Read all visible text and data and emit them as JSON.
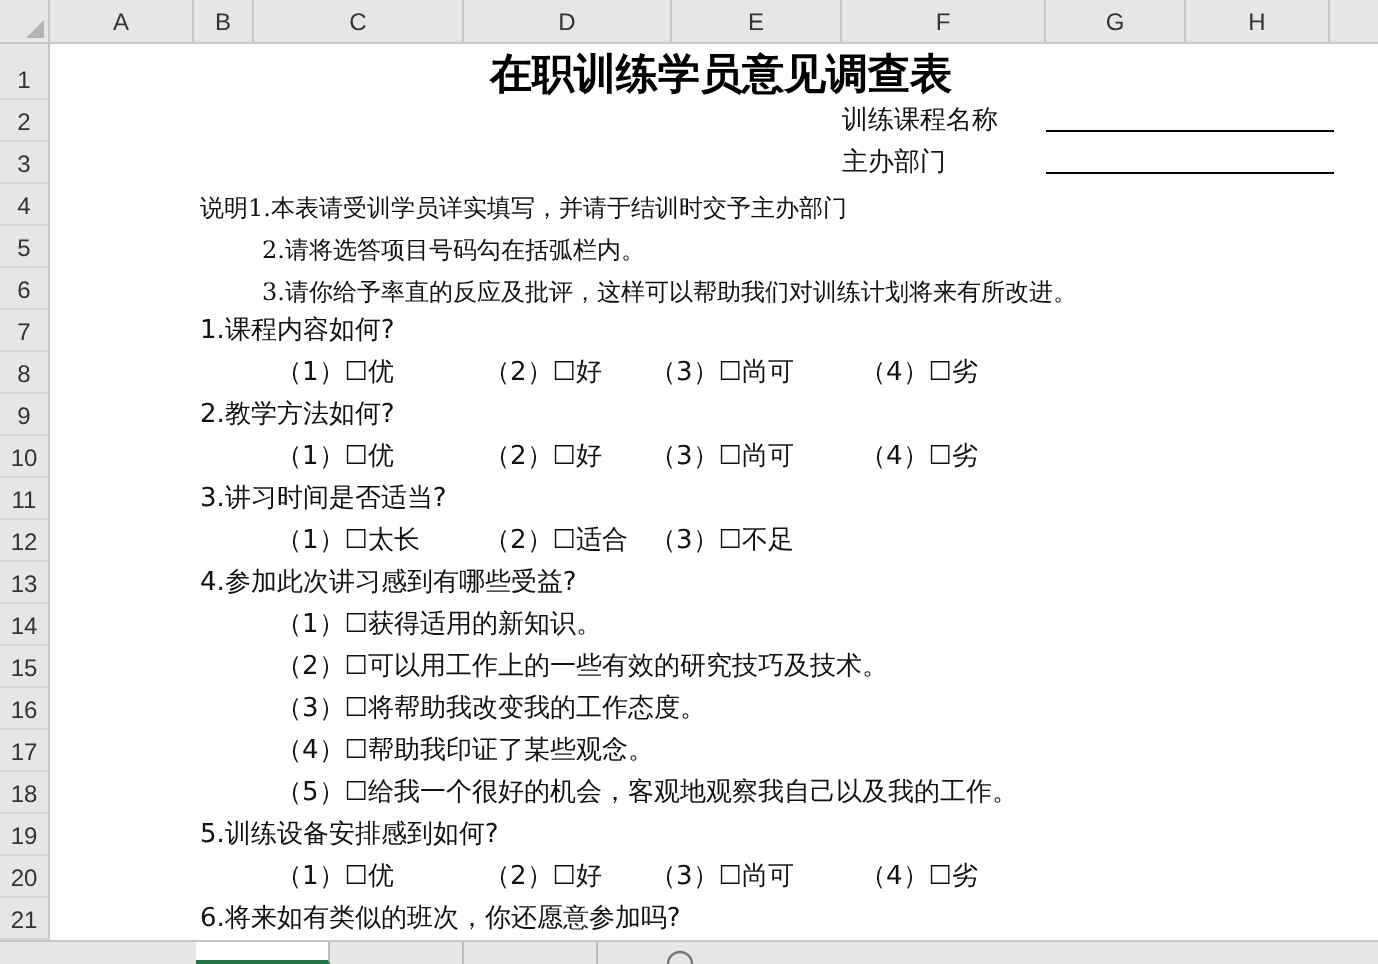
{
  "columns": [
    "A",
    "B",
    "C",
    "D",
    "E",
    "F",
    "G",
    "H"
  ],
  "rows": [
    {
      "number": "1",
      "kind": "title",
      "text": "在职训练学员意见调查表"
    },
    {
      "number": "2",
      "kind": "field",
      "text": "训练课程名称"
    },
    {
      "number": "3",
      "kind": "field",
      "text": "主办部门"
    },
    {
      "number": "4",
      "kind": "note_head",
      "text": "说明1.本表请受训学员详实填写，并请于结训时交予主办部门"
    },
    {
      "number": "5",
      "kind": "note",
      "text": "2.请将选答项目号码勾在括弧栏内。"
    },
    {
      "number": "6",
      "kind": "note",
      "text": "3.请你给予率直的反应及批评，这样可以帮助我们对训练计划将来有所改进。"
    },
    {
      "number": "7",
      "kind": "question",
      "text": "1.课程内容如何?"
    },
    {
      "number": "8",
      "kind": "options",
      "options": [
        "（1）☐优",
        "（2）☐好",
        "（3）☐尚可",
        "（4）☐劣"
      ]
    },
    {
      "number": "9",
      "kind": "question",
      "text": "2.教学方法如何?"
    },
    {
      "number": "10",
      "kind": "options",
      "options": [
        "（1）☐优",
        "（2）☐好",
        "（3）☐尚可",
        "（4）☐劣"
      ]
    },
    {
      "number": "11",
      "kind": "question",
      "text": "3.讲习时间是否适当?"
    },
    {
      "number": "12",
      "kind": "options",
      "options": [
        "（1）☐太长",
        "（2）☐适合",
        "（3）☐不足"
      ]
    },
    {
      "number": "13",
      "kind": "question",
      "text": "4.参加此次讲习感到有哪些受益?"
    },
    {
      "number": "14",
      "kind": "option",
      "text": "（1）☐获得适用的新知识。"
    },
    {
      "number": "15",
      "kind": "option",
      "text": "（2）☐可以用工作上的一些有效的研究技巧及技术。"
    },
    {
      "number": "16",
      "kind": "option",
      "text": "（3）☐将帮助我改变我的工作态度。"
    },
    {
      "number": "17",
      "kind": "option",
      "text": "（4）☐帮助我印证了某些观念。"
    },
    {
      "number": "18",
      "kind": "option",
      "text": "（5）☐给我一个很好的机会，客观地观察我自己以及我的工作。"
    },
    {
      "number": "19",
      "kind": "question",
      "text": "5.训练设备安排感到如何?"
    },
    {
      "number": "20",
      "kind": "options",
      "options": [
        "（1）☐优",
        "（2）☐好",
        "（3）☐尚可",
        "（4）☐劣"
      ]
    },
    {
      "number": "21",
      "kind": "question",
      "text": "6.将来如有类似的班次，你还愿意参加吗?"
    }
  ],
  "sheet_tabs": [
    {
      "selected": true
    },
    {
      "selected": false
    },
    {
      "selected": false
    }
  ]
}
